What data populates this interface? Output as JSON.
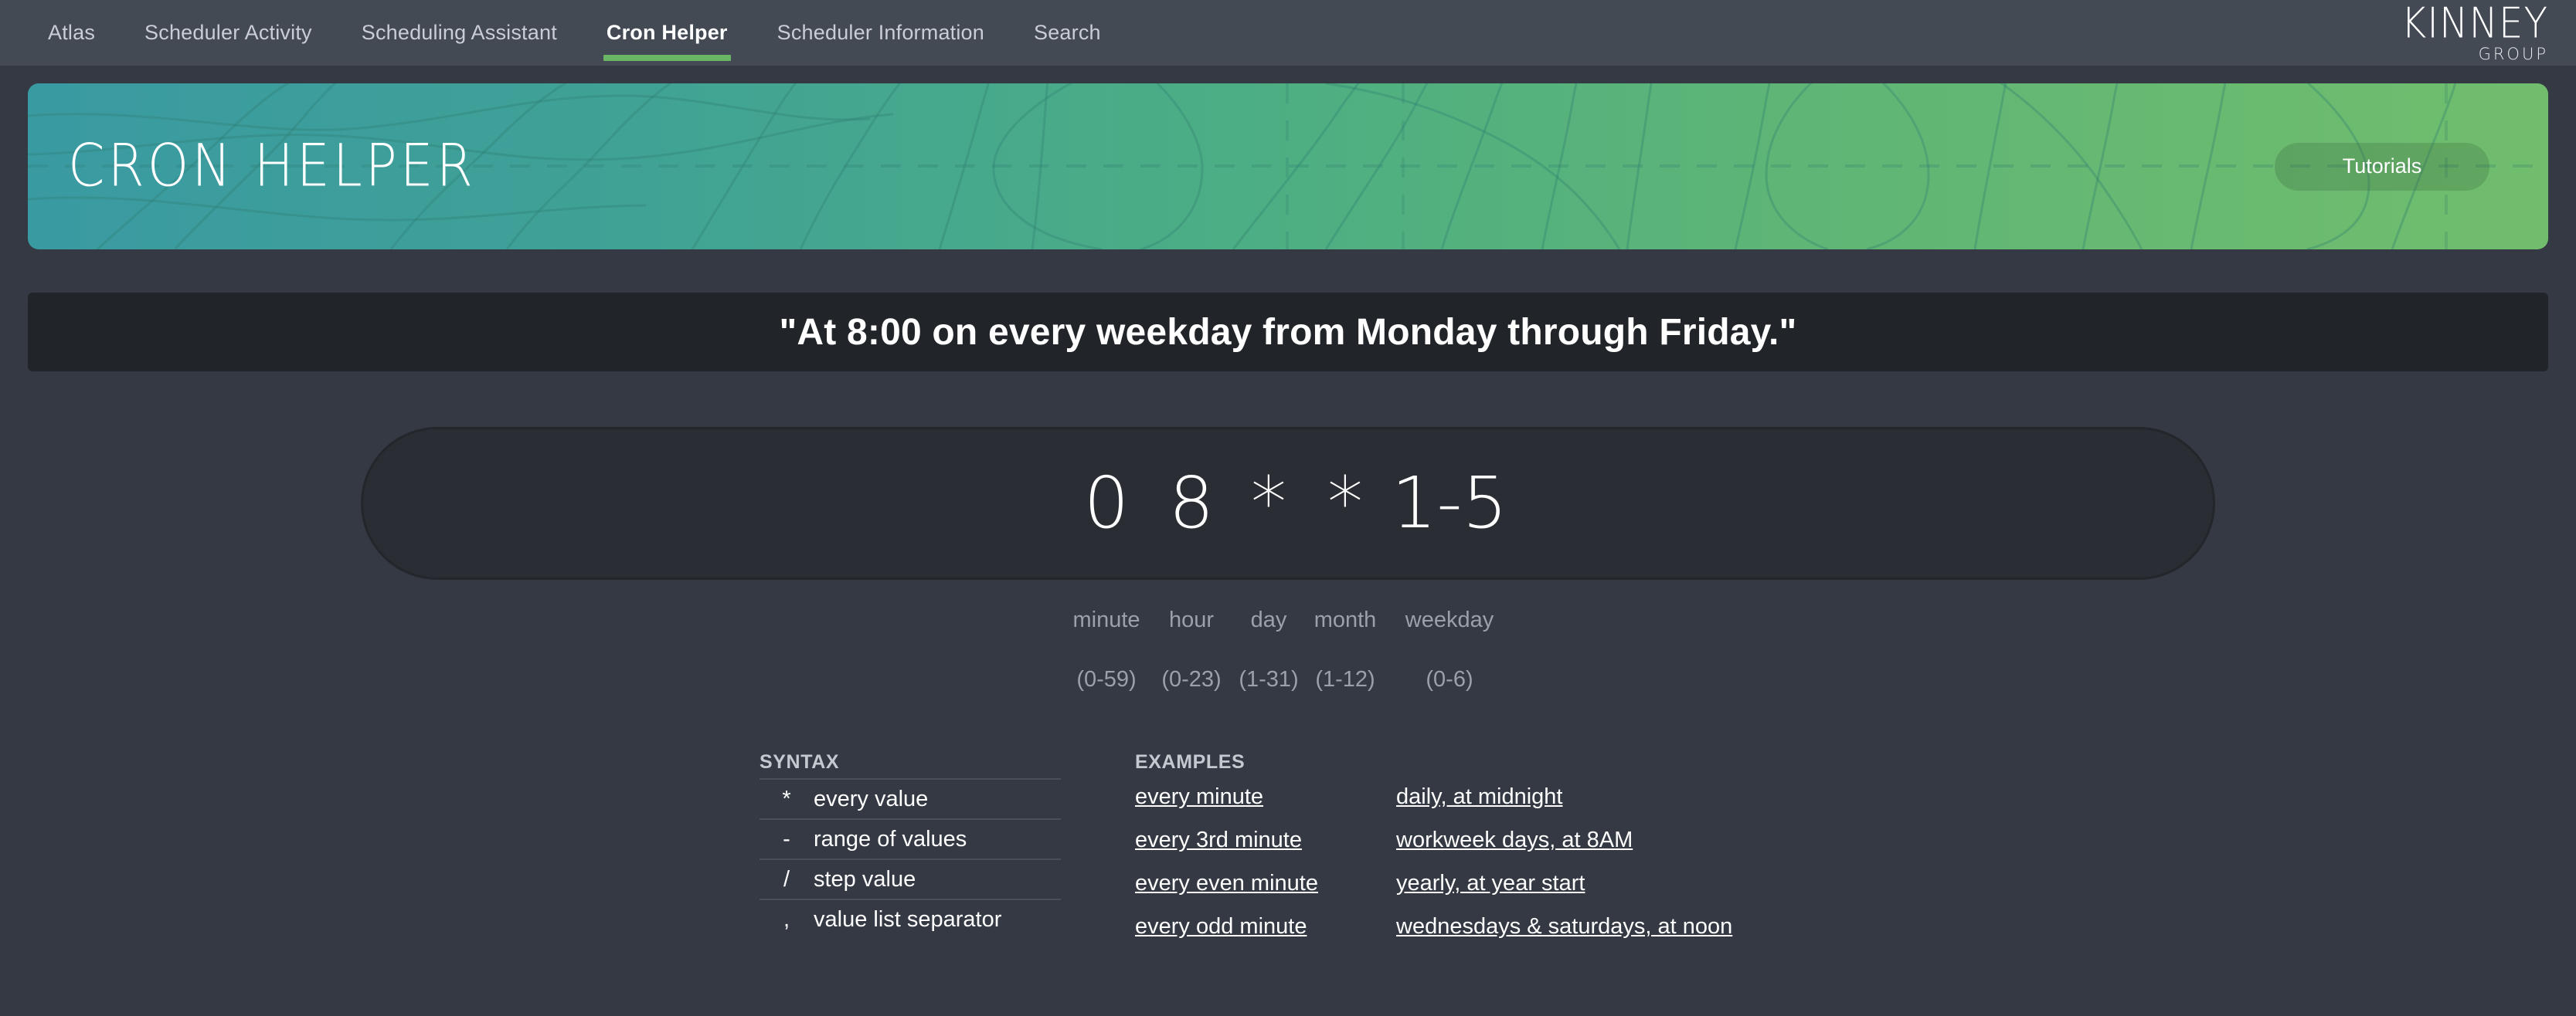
{
  "nav": {
    "items": [
      {
        "label": "Atlas",
        "active": false
      },
      {
        "label": "Scheduler Activity",
        "active": false
      },
      {
        "label": "Scheduling Assistant",
        "active": false
      },
      {
        "label": "Cron Helper",
        "active": true
      },
      {
        "label": "Scheduler Information",
        "active": false
      },
      {
        "label": "Search",
        "active": false
      }
    ],
    "brand": {
      "main": "KINNEY",
      "sub": "GROUP"
    }
  },
  "hero": {
    "title": "CRON HELPER",
    "tutorials_label": "Tutorials",
    "gradient_from": "#3a9aa2",
    "gradient_to": "#71bd6d"
  },
  "description": "\"At 8:00 on every weekday from Monday through Friday.\"",
  "cron": {
    "fields": [
      {
        "value": "0",
        "label": "minute",
        "range": "(0-59)"
      },
      {
        "value": "8",
        "label": "hour",
        "range": "(0-23)"
      },
      {
        "value": "*",
        "label": "day",
        "range": "(1-31)"
      },
      {
        "value": "*",
        "label": "month",
        "range": "(1-12)"
      },
      {
        "value": "1-5",
        "label": "weekday",
        "range": "(0-6)"
      }
    ]
  },
  "syntax": {
    "heading": "SYNTAX",
    "rows": [
      {
        "symbol": "*",
        "description": "every value"
      },
      {
        "symbol": "-",
        "description": "range of values"
      },
      {
        "symbol": "/",
        "description": "step value"
      },
      {
        "symbol": ",",
        "description": "value list separator"
      }
    ]
  },
  "examples": {
    "heading": "EXAMPLES",
    "column_left": [
      "every minute",
      "every 3rd minute",
      "every even minute",
      "every odd minute"
    ],
    "column_right": [
      "daily, at midnight",
      "workweek days, at 8AM",
      "yearly, at year start",
      "wednesdays & saturdays, at noon"
    ]
  },
  "theme": {
    "nav_background": "#434A54",
    "page_background": "#343943",
    "description_background": "#212529",
    "active_tab_underline": "#6ab563",
    "cron_box_background": "#2a2e34"
  }
}
